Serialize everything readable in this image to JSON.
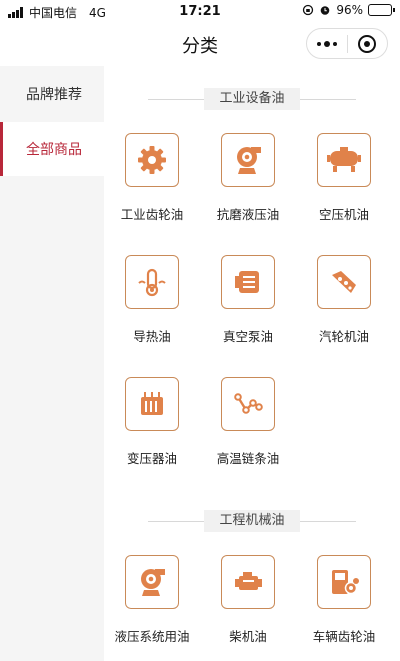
{
  "status_bar": {
    "carrier": "中国电信",
    "network": "4G",
    "time": "17:21",
    "battery": "96%",
    "battery_level": 0.96
  },
  "header": {
    "title": "分类"
  },
  "sidebar": {
    "items": [
      {
        "label": "品牌推荐",
        "active": false
      },
      {
        "label": "全部商品",
        "active": true
      }
    ]
  },
  "sections": [
    {
      "title": "工业设备油",
      "items": [
        {
          "label": "工业齿轮油",
          "icon": "gear-icon"
        },
        {
          "label": "抗磨液压油",
          "icon": "hydraulic-pump-icon"
        },
        {
          "label": "空压机油",
          "icon": "air-compressor-icon"
        },
        {
          "label": "导热油",
          "icon": "heat-transfer-icon"
        },
        {
          "label": "真空泵油",
          "icon": "vacuum-pump-icon"
        },
        {
          "label": "汽轮机油",
          "icon": "turbine-icon"
        },
        {
          "label": "变压器油",
          "icon": "transformer-icon"
        },
        {
          "label": "高温链条油",
          "icon": "chain-icon"
        }
      ]
    },
    {
      "title": "工程机械油",
      "items": [
        {
          "label": "液压系统用油",
          "icon": "hydraulic-system-icon"
        },
        {
          "label": "柴机油",
          "icon": "engine-icon"
        },
        {
          "label": "车辆齿轮油",
          "icon": "vehicle-gear-icon"
        }
      ]
    }
  ],
  "colors": {
    "accent": "#b8283a",
    "icon_border": "#c98a58",
    "icon_fill": "#e0824a"
  }
}
